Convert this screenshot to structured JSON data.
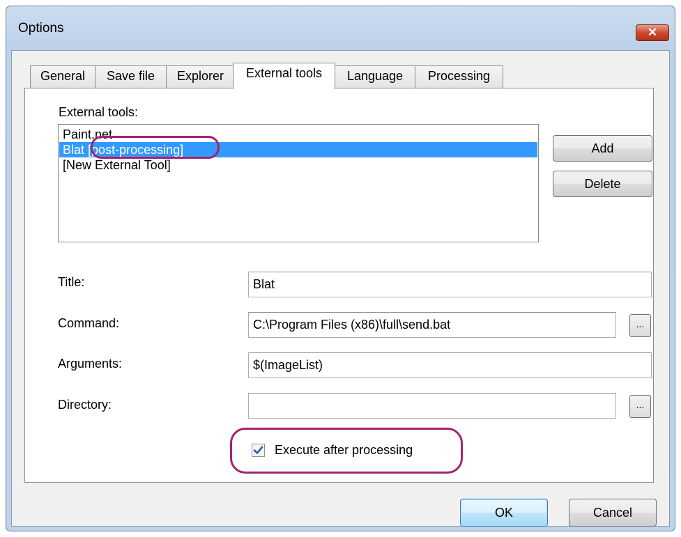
{
  "window": {
    "title": "Options",
    "close_icon": "close-icon"
  },
  "tabs": [
    {
      "label": "General"
    },
    {
      "label": "Save file"
    },
    {
      "label": "Explorer"
    },
    {
      "label": "External tools"
    },
    {
      "label": "Language"
    },
    {
      "label": "Processing"
    }
  ],
  "active_tab": "External tools",
  "external_tools": {
    "label": "External tools:",
    "items": [
      {
        "name": "Paint.net",
        "tag": ""
      },
      {
        "name": "Blat",
        "tag": "[post-processing]"
      },
      {
        "name": "[New External Tool]",
        "tag": ""
      }
    ],
    "selected_index": 1,
    "add_label": "Add",
    "delete_label": "Delete"
  },
  "form": {
    "title_label": "Title:",
    "title_value": "Blat",
    "command_label": "Command:",
    "command_value": "C:\\Program Files (x86)\\full\\send.bat",
    "arguments_label": "Arguments:",
    "arguments_value": "$(ImageList)",
    "directory_label": "Directory:",
    "directory_value": "",
    "browse_label": "...",
    "execute_after_label": "Execute after processing",
    "execute_after_checked": true
  },
  "footer": {
    "ok_label": "OK",
    "cancel_label": "Cancel"
  },
  "colors": {
    "highlight_oval": "#a3246e",
    "selection": "#3399ff"
  }
}
